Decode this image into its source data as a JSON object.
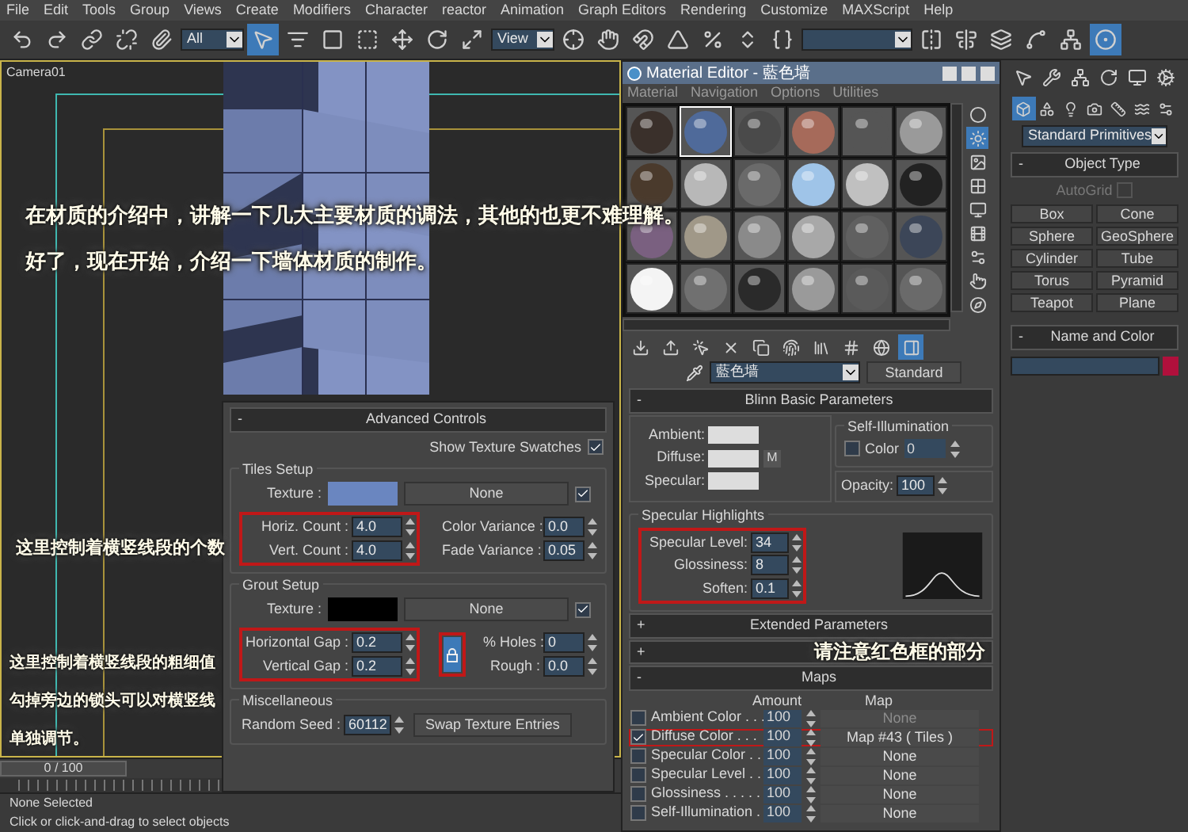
{
  "menu": [
    "File",
    "Edit",
    "Tools",
    "Group",
    "Views",
    "Create",
    "Modifiers",
    "Character",
    "reactor",
    "Animation",
    "Graph Editors",
    "Rendering",
    "Customize",
    "MAXScript",
    "Help"
  ],
  "toolbar": [
    {
      "kind": "undo",
      "selected": false
    },
    {
      "kind": "redo",
      "selected": false
    },
    {
      "kind": "link",
      "selected": false
    },
    {
      "kind": "unlink",
      "selected": false
    },
    {
      "kind": "bind",
      "selected": false
    },
    {
      "kind": "dropdown",
      "value": "All"
    },
    {
      "kind": "select",
      "selected": true
    },
    {
      "kind": "select_by_name",
      "selected": false
    },
    {
      "kind": "region",
      "selected": false
    },
    {
      "kind": "crossing",
      "selected": false
    },
    {
      "kind": "move",
      "selected": false
    },
    {
      "kind": "rotate",
      "selected": false
    },
    {
      "kind": "scale",
      "selected": false
    },
    {
      "kind": "dropdown",
      "value": "View"
    },
    {
      "kind": "pivot",
      "selected": false
    },
    {
      "kind": "manipulate",
      "selected": false
    },
    {
      "kind": "snap",
      "selected": false
    },
    {
      "kind": "angle_snap",
      "selected": false
    },
    {
      "kind": "percent_snap",
      "selected": false
    },
    {
      "kind": "spinner_snap",
      "selected": false
    },
    {
      "kind": "named_sets",
      "selected": false
    },
    {
      "kind": "dropdown"
    },
    {
      "kind": "mirror",
      "selected": false
    },
    {
      "kind": "align",
      "selected": false
    },
    {
      "kind": "layers",
      "selected": false
    },
    {
      "kind": "curve_editor",
      "selected": false
    },
    {
      "kind": "schematic",
      "selected": false
    },
    {
      "kind": "material",
      "selected": true
    }
  ],
  "viewport": {
    "label": "Camera01"
  },
  "captions": [
    "在材质的介绍中，讲解一下几大主要材质的调法，其他的也更不难理解。",
    "好了，现在开始，介绍一下墙体材质的制作。"
  ],
  "count_note": "这里控制着横竖线段的个数",
  "gap_note": [
    "这里控制着横竖线段的粗细值",
    "勾掉旁边的锁头可以对横竖线",
    "单独调节。"
  ],
  "maps_note": "请注意红色框的部分",
  "advanced_controls": {
    "sign": "-",
    "title": "Advanced Controls",
    "show_swatches": {
      "label": "Show Texture Swatches",
      "checked": true
    },
    "tiles": {
      "title": "Tiles Setup",
      "texture": {
        "label": "Texture :",
        "color": "#6a86c0",
        "map": "None",
        "checked": true
      },
      "left": [
        {
          "label": "Horiz. Count :",
          "value": "4.0"
        },
        {
          "label": "Vert. Count :",
          "value": "4.0"
        }
      ],
      "right": [
        {
          "label": "Color Variance :",
          "value": "0.0"
        },
        {
          "label": "Fade Variance :",
          "value": "0.05"
        }
      ]
    },
    "grout": {
      "title": "Grout Setup",
      "texture": {
        "label": "Texture :",
        "color": "#000000",
        "map": "None",
        "checked": true
      },
      "left": [
        {
          "label": "Horizontal Gap :",
          "value": "0.2"
        },
        {
          "label": "Vertical Gap :",
          "value": "0.2"
        }
      ],
      "lock": {
        "on": true
      },
      "right": [
        {
          "label": "% Holes :",
          "value": "0"
        },
        {
          "label": "Rough :",
          "value": "0.0"
        }
      ]
    },
    "misc": {
      "title": "Miscellaneous",
      "seed": {
        "label": "Random Seed :",
        "value": "60112"
      },
      "swap": "Swap Texture Entries"
    }
  },
  "material_editor": {
    "title": "Material Editor - 藍色墙",
    "menu": [
      "Material",
      "Navigation",
      "Options",
      "Utilities"
    ],
    "slots": [
      {
        "color": "#3a302b",
        "selected": false
      },
      {
        "color": "#4f6a9a",
        "selected": true
      },
      {
        "color": "#4a4a4a",
        "selected": false
      },
      {
        "color": "#a66a5a",
        "selected": false
      },
      {
        "color": "#555555",
        "selected": false
      },
      {
        "color": "#9a9a9a",
        "selected": false
      },
      {
        "color": "#4a3a2c",
        "selected": false
      },
      {
        "color": "#b8b8b8",
        "selected": false
      },
      {
        "color": "#6a6a6a",
        "selected": false
      },
      {
        "color": "#9fc4e8",
        "selected": false
      },
      {
        "color": "#c0c0c0",
        "selected": false
      },
      {
        "color": "#222222",
        "selected": false
      },
      {
        "color": "#7a6080",
        "selected": false
      },
      {
        "color": "#a09888",
        "selected": false
      },
      {
        "color": "#8a8a8a",
        "selected": false
      },
      {
        "color": "#a8a8a8",
        "selected": false
      },
      {
        "color": "#606060",
        "selected": false
      },
      {
        "color": "#3c4658",
        "selected": false
      },
      {
        "color": "#f4f4f4",
        "selected": false
      },
      {
        "color": "#707070",
        "selected": false
      },
      {
        "color": "#2a2a2a",
        "selected": false
      },
      {
        "color": "#9a9a9a",
        "selected": false
      },
      {
        "color": "#5a5a5a",
        "selected": false
      },
      {
        "color": "#6a6a6a",
        "selected": false
      }
    ],
    "side_tools": [
      {
        "kind": "sample_type",
        "selected": false
      },
      {
        "kind": "backlight",
        "selected": true
      },
      {
        "kind": "background",
        "selected": false
      },
      {
        "kind": "uv_tiling",
        "selected": false
      },
      {
        "kind": "video_check",
        "selected": false
      },
      {
        "kind": "preview",
        "selected": false
      },
      {
        "kind": "options",
        "selected": false
      },
      {
        "kind": "select_by_material",
        "selected": false
      },
      {
        "kind": "navigator",
        "selected": false
      }
    ],
    "bottom_tools": [
      {
        "kind": "get",
        "selected": false
      },
      {
        "kind": "put",
        "selected": false
      },
      {
        "kind": "assign",
        "selected": false
      },
      {
        "kind": "reset",
        "selected": false
      },
      {
        "kind": "copy",
        "selected": false
      },
      {
        "kind": "unique",
        "selected": false
      },
      {
        "kind": "library",
        "selected": false
      },
      {
        "kind": "effects",
        "selected": false
      },
      {
        "kind": "show_map",
        "selected": false
      },
      {
        "kind": "show_end",
        "selected": true
      }
    ],
    "material_name": "藍色墙",
    "material_type": "Standard",
    "blinn": {
      "sign": "-",
      "title": "Blinn Basic Parameters",
      "colors": [
        {
          "label": "Ambient:"
        },
        {
          "label": "Diffuse:"
        },
        {
          "label": "Specular:"
        }
      ],
      "map_button": "M",
      "self_illum": {
        "title": "Self-Illumination",
        "label": "Color",
        "checked": false,
        "value": "0"
      },
      "opacity": {
        "label": "Opacity:",
        "value": "100"
      },
      "highlights": {
        "title": "Specular Highlights",
        "fields": [
          {
            "label": "Specular Level:",
            "value": "34"
          },
          {
            "label": "Glossiness:",
            "value": "8"
          },
          {
            "label": "Soften:",
            "value": "0.1"
          }
        ]
      }
    },
    "extended": {
      "sign": "+",
      "title": "Extended Parameters"
    },
    "rollout_3": {
      "sign": "+"
    },
    "maps": {
      "sign": "-",
      "title": "Maps",
      "columns": [
        "Amount",
        "Map"
      ],
      "rows": [
        {
          "label": "Ambient Color . . .",
          "checked": false,
          "amount": "100",
          "map": "None",
          "disabled": true
        },
        {
          "label": "Diffuse Color . . .",
          "checked": true,
          "amount": "100",
          "map": "Map #43 ( Tiles )",
          "disabled": false
        },
        {
          "label": "Specular Color . .",
          "checked": false,
          "amount": "100",
          "map": "None",
          "disabled": false
        },
        {
          "label": "Specular Level . .",
          "checked": false,
          "amount": "100",
          "map": "None",
          "disabled": false
        },
        {
          "label": "Glossiness . . . . .",
          "checked": false,
          "amount": "100",
          "map": "None",
          "disabled": false
        },
        {
          "label": "Self-Illumination .",
          "checked": false,
          "amount": "100",
          "map": "None",
          "disabled": false
        }
      ]
    }
  },
  "command_panel": {
    "tabs": [
      {
        "kind": "create",
        "selected": false
      },
      {
        "kind": "modify",
        "selected": false
      },
      {
        "kind": "hierarchy",
        "selected": false
      },
      {
        "kind": "motion",
        "selected": false
      },
      {
        "kind": "display",
        "selected": false
      },
      {
        "kind": "utilities",
        "selected": false
      }
    ],
    "categories": [
      {
        "kind": "geometry",
        "selected": true
      },
      {
        "kind": "shapes",
        "selected": false
      },
      {
        "kind": "lights",
        "selected": false
      },
      {
        "kind": "cameras",
        "selected": false
      },
      {
        "kind": "helpers",
        "selected": false
      },
      {
        "kind": "space_warps",
        "selected": false
      },
      {
        "kind": "systems",
        "selected": false
      }
    ],
    "type_dropdown": "Standard Primitives",
    "object_type": {
      "sign": "-",
      "title": "Object Type",
      "autogrid": {
        "label": "AutoGrid",
        "checked": false
      },
      "buttons": [
        "Box",
        "Cone",
        "Sphere",
        "GeoSphere",
        "Cylinder",
        "Tube",
        "Torus",
        "Pyramid",
        "Teapot",
        "Plane"
      ]
    },
    "name_color": {
      "sign": "-",
      "title": "Name and Color",
      "color": "#b0103c"
    }
  },
  "time_slider": {
    "label": "0 / 100",
    "level": 0
  },
  "status": "None Selected",
  "prompt": "Click or click-and-drag to select objects"
}
